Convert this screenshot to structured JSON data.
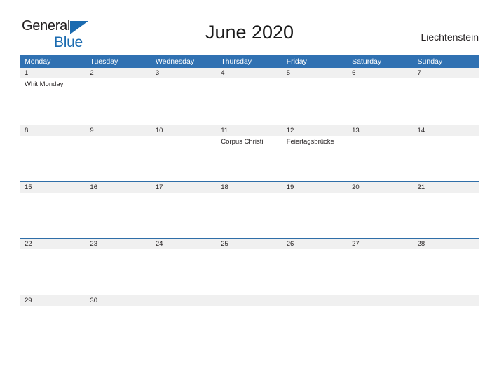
{
  "brand": {
    "name_part1": "General",
    "name_part2": "Blue",
    "triangle_icon": "triangle-logo-icon",
    "accent_color": "#1b6bb0"
  },
  "header": {
    "title": "June 2020",
    "region": "Liechtenstein"
  },
  "theme": {
    "header_blue": "#3071b2",
    "row_divider_blue": "#2f6ea8",
    "daynum_band_gray": "#f0f0f0",
    "text_color": "#231f20"
  },
  "calendar": {
    "weekdays": [
      "Monday",
      "Tuesday",
      "Wednesday",
      "Thursday",
      "Friday",
      "Saturday",
      "Sunday"
    ],
    "weeks": [
      {
        "days": [
          {
            "date": "1",
            "events": [
              "Whit Monday"
            ]
          },
          {
            "date": "2",
            "events": []
          },
          {
            "date": "3",
            "events": []
          },
          {
            "date": "4",
            "events": []
          },
          {
            "date": "5",
            "events": []
          },
          {
            "date": "6",
            "events": []
          },
          {
            "date": "7",
            "events": []
          }
        ]
      },
      {
        "days": [
          {
            "date": "8",
            "events": []
          },
          {
            "date": "9",
            "events": []
          },
          {
            "date": "10",
            "events": []
          },
          {
            "date": "11",
            "events": [
              "Corpus Christi"
            ]
          },
          {
            "date": "12",
            "events": [
              "Feiertagsbrücke"
            ]
          },
          {
            "date": "13",
            "events": []
          },
          {
            "date": "14",
            "events": []
          }
        ]
      },
      {
        "days": [
          {
            "date": "15",
            "events": []
          },
          {
            "date": "16",
            "events": []
          },
          {
            "date": "17",
            "events": []
          },
          {
            "date": "18",
            "events": []
          },
          {
            "date": "19",
            "events": []
          },
          {
            "date": "20",
            "events": []
          },
          {
            "date": "21",
            "events": []
          }
        ]
      },
      {
        "days": [
          {
            "date": "22",
            "events": []
          },
          {
            "date": "23",
            "events": []
          },
          {
            "date": "24",
            "events": []
          },
          {
            "date": "25",
            "events": []
          },
          {
            "date": "26",
            "events": []
          },
          {
            "date": "27",
            "events": []
          },
          {
            "date": "28",
            "events": []
          }
        ]
      },
      {
        "days": [
          {
            "date": "29",
            "events": []
          },
          {
            "date": "30",
            "events": []
          },
          {
            "date": "",
            "events": []
          },
          {
            "date": "",
            "events": []
          },
          {
            "date": "",
            "events": []
          },
          {
            "date": "",
            "events": []
          },
          {
            "date": "",
            "events": []
          }
        ]
      }
    ]
  }
}
